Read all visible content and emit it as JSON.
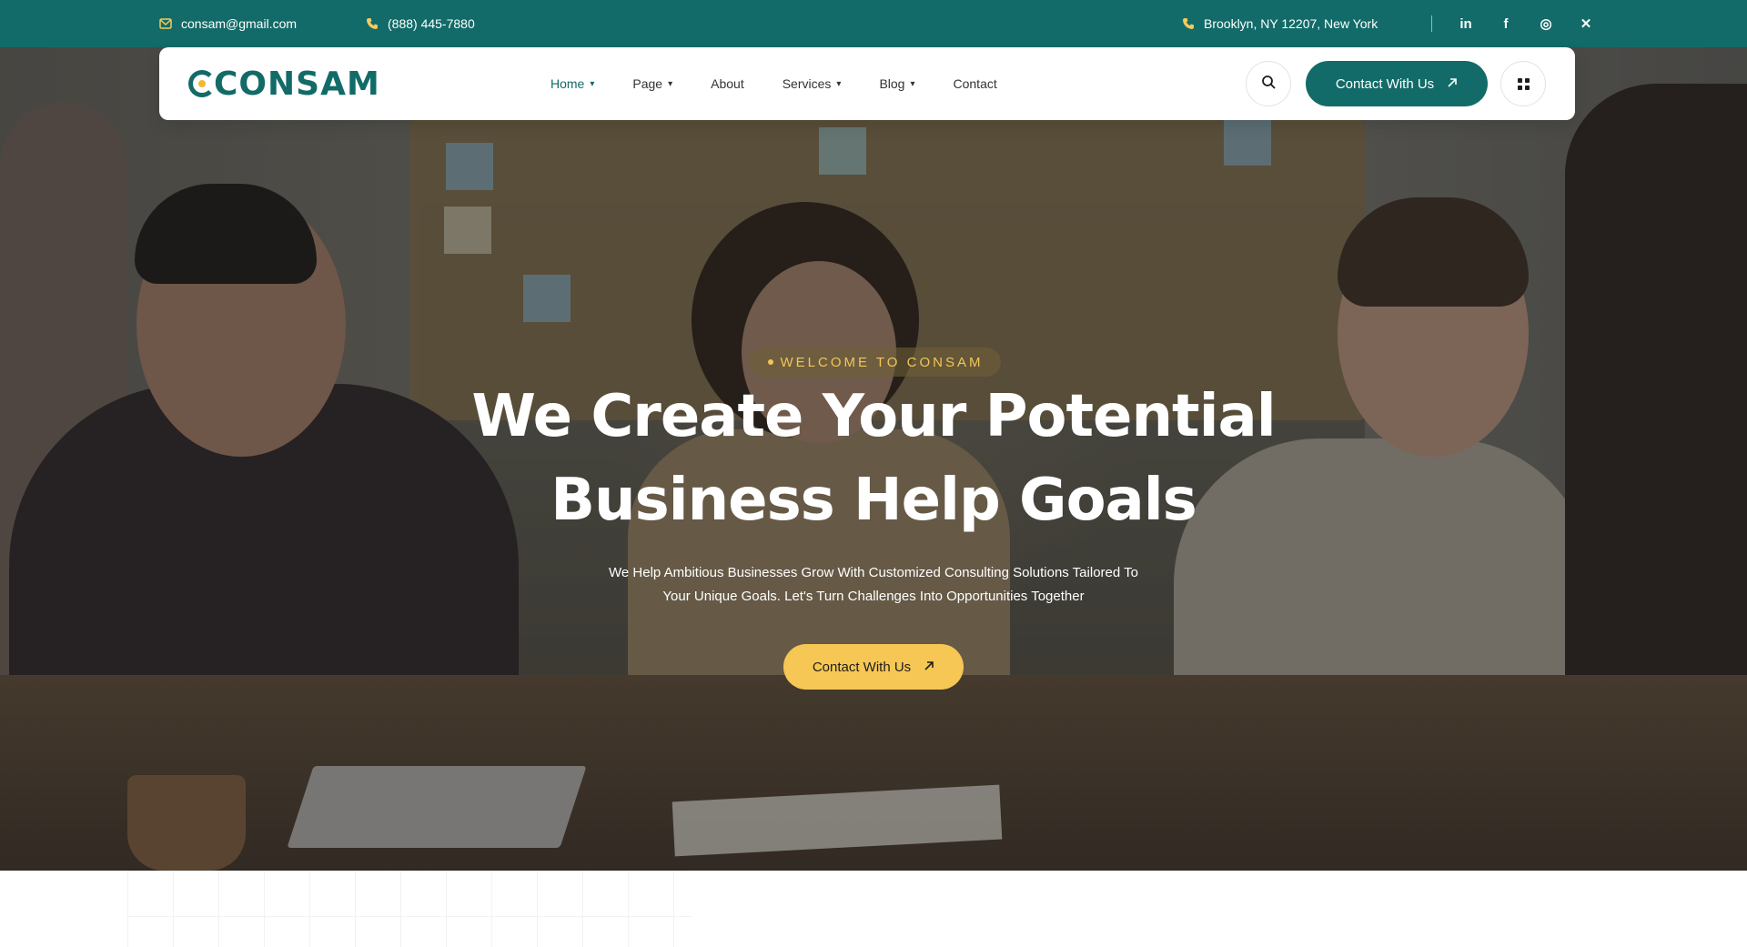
{
  "topbar": {
    "email": "consam@gmail.com",
    "phone": "(888) 445-7880",
    "address": "Brooklyn, NY 12207, New York",
    "socials": [
      {
        "name": "linkedin",
        "glyph": "in"
      },
      {
        "name": "facebook",
        "glyph": "f"
      },
      {
        "name": "instagram",
        "glyph": "◎"
      },
      {
        "name": "x",
        "glyph": "✕"
      }
    ],
    "icons": {
      "email": "email-icon",
      "phone": "phone-icon",
      "address": "phone-icon"
    }
  },
  "header": {
    "logo": "CONSAM",
    "nav": [
      {
        "label": "Home",
        "dropdown": true,
        "active": true
      },
      {
        "label": "Page",
        "dropdown": true
      },
      {
        "label": "About",
        "dropdown": false
      },
      {
        "label": "Services",
        "dropdown": true
      },
      {
        "label": "Blog",
        "dropdown": true
      },
      {
        "label": "Contact",
        "dropdown": false
      }
    ],
    "cta_label": "Contact With Us",
    "icons": {
      "search": "search-icon",
      "menu": "grid-menu-icon",
      "arrow": "arrow-up-right-icon"
    }
  },
  "hero": {
    "eyebrow": "WELCOME TO CONSAM",
    "title_line1": "We Create Your Potential",
    "title_line2": "Business Help Goals",
    "subtitle_line1": "We Help Ambitious Businesses Grow With Customized Consulting Solutions Tailored To",
    "subtitle_line2": "Your Unique Goals. Let's Turn Challenges Into Opportunities Together",
    "cta_label": "Contact With Us"
  },
  "colors": {
    "brand": "#126b68",
    "accent": "#f6c755",
    "topbar_bg": "#126b68"
  }
}
